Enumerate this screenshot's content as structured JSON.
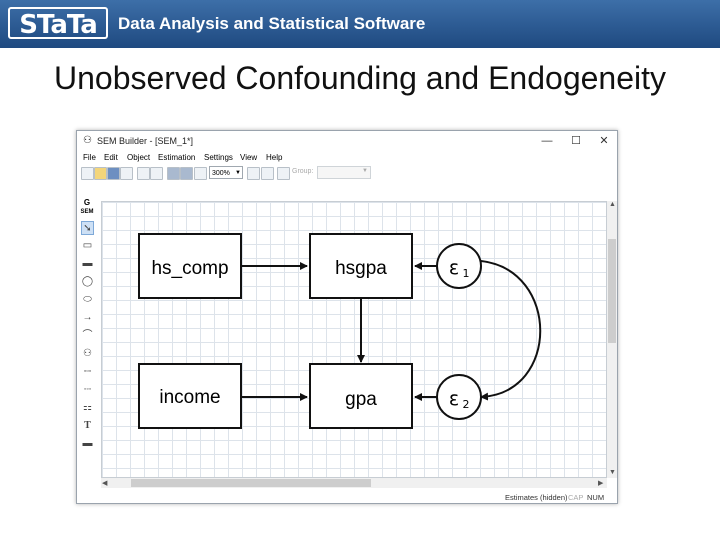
{
  "banner": {
    "logo_text": "STaTa",
    "tagline": "Data Analysis and Statistical Software",
    "background_color": "#2c5a92"
  },
  "slide": {
    "title": "Unobserved Confounding and Endogeneity"
  },
  "window": {
    "title": "SEM Builder - [SEM_1*]",
    "controls": {
      "minimize": "—",
      "maximize": "☐",
      "close": "✕"
    }
  },
  "menu": [
    "File",
    "Edit",
    "Object",
    "Estimation",
    "Settings",
    "View",
    "Help"
  ],
  "toolbar": {
    "zoom_value": "300%",
    "group_label": "Group:",
    "icons": [
      "new-icon",
      "open-icon",
      "save-icon",
      "print-icon",
      "copy-icon",
      "paste-icon",
      "undo-icon",
      "redo-icon",
      "estimate-icon",
      "zoom-select",
      "fit-icon",
      "move-icon",
      "group-select"
    ]
  },
  "sidebar": {
    "mode_label_top": "G",
    "mode_label_bottom": "SEM",
    "tools": [
      "select-tool",
      "observed-variable-tool",
      "generalized-variable-tool",
      "latent-variable-tool",
      "multilevel-latent-tool",
      "path-tool",
      "covariance-tool",
      "measurement-component-tool",
      "regression-component-tool",
      "observed-regression-tool",
      "latent-regression-tool",
      "text-tool",
      "area-tool"
    ]
  },
  "diagram": {
    "nodes": {
      "hs_comp": "hs_comp",
      "hsgpa": "hsgpa",
      "income": "income",
      "gpa": "gpa"
    },
    "errors": {
      "e1_symbol": "ε",
      "e1_index": "1",
      "e2_symbol": "ε",
      "e2_index": "2"
    }
  },
  "statusbar": {
    "estimates": "Estimates (hidden)",
    "cap": "CAP",
    "num": "NUM"
  }
}
